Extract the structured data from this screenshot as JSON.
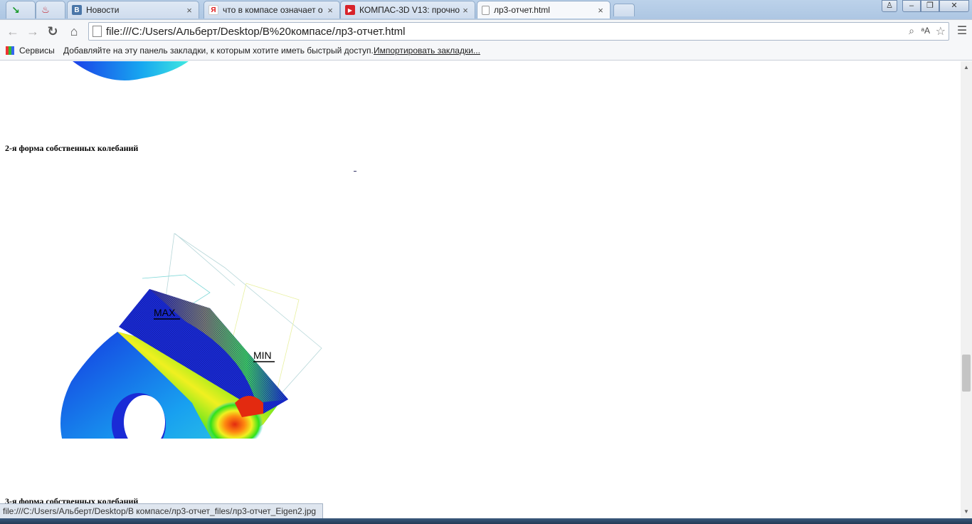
{
  "tabs": [
    {
      "label": ""
    },
    {
      "label": ""
    },
    {
      "label": "Новости",
      "favicon": "vk"
    },
    {
      "label": "что в компасе означает о",
      "favicon": "yandex"
    },
    {
      "label": "КОМПАС-3D V13: прочно",
      "favicon": "youtube"
    },
    {
      "label": "лр3-отчет.html",
      "favicon": "page"
    }
  ],
  "toolbar": {
    "url": "file:///C:/Users/Альберт/Desktop/В%20компасе/лр3-отчет.html"
  },
  "bookmarks": {
    "apps_label": "Сервисы",
    "hint": "Добавляйте на эту панель закладки, к которым хотите иметь быстрый доступ.",
    "import_link": "Импортировать закладки..."
  },
  "content": {
    "heading2": "2-я форма собственных колебаний",
    "heading3": "3-я форма собственных колебаний",
    "label_max": "MAX",
    "label_min": "MIN"
  },
  "status": {
    "url": "file:///C:/Users/Альберт/Desktop/В компасе/лр3-отчет_files/лр3-отчет_Eigen2.jpg"
  },
  "colors": {
    "fea_blue": "#1a2bd6",
    "fea_red": "#e32a10",
    "fea_green": "#2fe21a",
    "fea_yellow": "#f0f020",
    "fea_cyan": "#14c9f0"
  }
}
